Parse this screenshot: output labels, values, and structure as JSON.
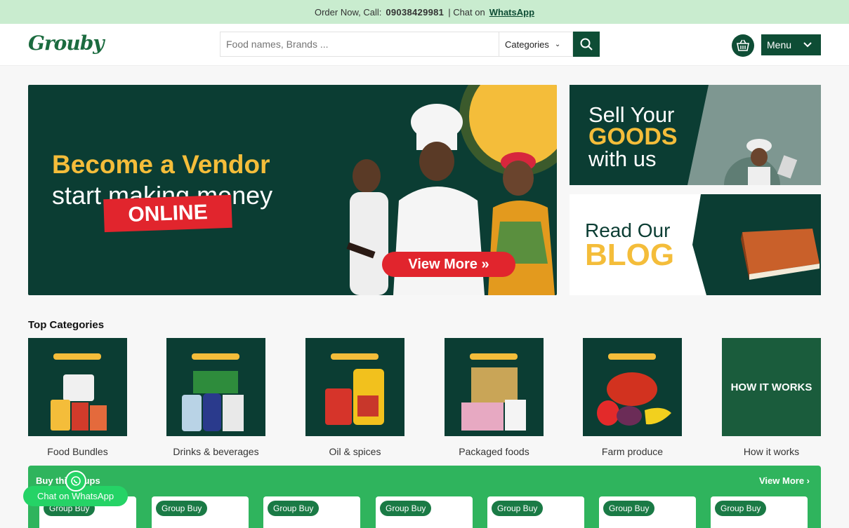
{
  "topbar": {
    "order_text": "Order Now, Call:",
    "phone": "09038429981",
    "chat_text": "| Chat on",
    "whatsapp_link": "WhatsApp"
  },
  "header": {
    "logo": "Grouby",
    "search_placeholder": "Food names, Brands ...",
    "categories_label": "Categories",
    "menu_label": "Menu"
  },
  "hero": {
    "line1": "Become a Vendor",
    "line2": "start making money",
    "line3": "ONLINE",
    "cta": "View More »"
  },
  "promo_sell": {
    "line1": "Sell Your",
    "line2": "GOODS",
    "line3": "with us"
  },
  "promo_blog": {
    "line1": "Read Our",
    "line2": "BLOG"
  },
  "top_categories": {
    "title": "Top Categories",
    "items": [
      {
        "label": "Food Bundles"
      },
      {
        "label": "Drinks & beverages"
      },
      {
        "label": "Oil & spices"
      },
      {
        "label": "Packaged foods"
      },
      {
        "label": "Farm produce"
      },
      {
        "label": "How it works",
        "tile_text": "HOW IT WORKS"
      }
    ]
  },
  "group_buy": {
    "title": "Buy thi   groups",
    "view_more": "View More  ›",
    "badge": "Group Buy"
  },
  "whatsapp_chat": {
    "label": "Chat on WhatsApp"
  },
  "colors": {
    "brand_dark": "#0e4d35",
    "accent_yellow": "#f4bd3a",
    "accent_red": "#e1252d",
    "group_green": "#2fb45d"
  }
}
